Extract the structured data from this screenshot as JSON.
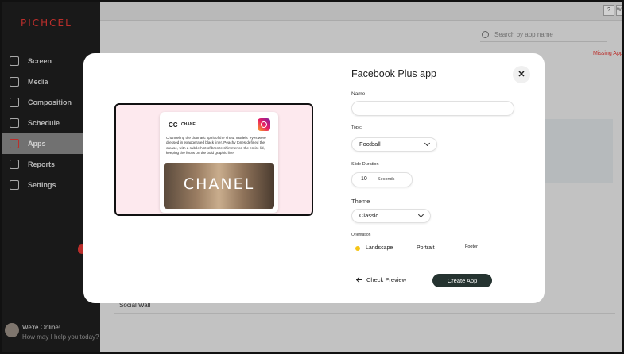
{
  "sidebar": {
    "logo": "PICHCEL",
    "items": [
      {
        "label": "Screen",
        "icon": "monitor-icon"
      },
      {
        "label": "Media",
        "icon": "folder-icon"
      },
      {
        "label": "Composition",
        "icon": "edit-icon"
      },
      {
        "label": "Schedule",
        "icon": "calendar-icon"
      },
      {
        "label": "Apps",
        "icon": "grid-icon",
        "active": true
      },
      {
        "label": "Reports",
        "icon": "pie-chart-icon"
      },
      {
        "label": "Settings",
        "icon": "gear-icon"
      }
    ],
    "chat": {
      "title": "We're Online!",
      "subtitle": "How may I help you today?"
    }
  },
  "topbar": {
    "help": "?",
    "user": "WB"
  },
  "background": {
    "search_placeholder": "Search by app name",
    "missing_app": "Missing App",
    "social_wall": "Social Wall"
  },
  "modal": {
    "title": "Facebook Plus app",
    "close": "✕",
    "preview": {
      "brand_mark": "CC",
      "brand_name": "CHANEL",
      "text": "Channeling the dramatic spirit of the show, models' eyes were dressed in exaggerated black liner. Peachy tones defined the crease, with a subtle hint of bronze shimmer on the entire lid, keeping the focus on the bold graphic line.",
      "image_text": "CHANEL"
    },
    "form": {
      "name_label": "Name",
      "name_value": "",
      "topic_label": "Topic",
      "topic_value": "Football",
      "duration_label": "Slide Duration",
      "duration_value": "10",
      "duration_unit": "Seconds",
      "theme_label": "Theme",
      "theme_value": "Classic",
      "orientation_label": "Orientation",
      "orientation_landscape": "Landscape",
      "orientation_portrait": "Portrait",
      "orientation_footer": "Footer",
      "selected_orientation": "Landscape"
    },
    "actions": {
      "check_preview": "Check Preview",
      "create_app": "Create App"
    }
  },
  "colors": {
    "accent": "#e53935",
    "sidebar": "#1f1f1f",
    "primary_button": "#253330",
    "radio_selected": "#f5c518"
  }
}
